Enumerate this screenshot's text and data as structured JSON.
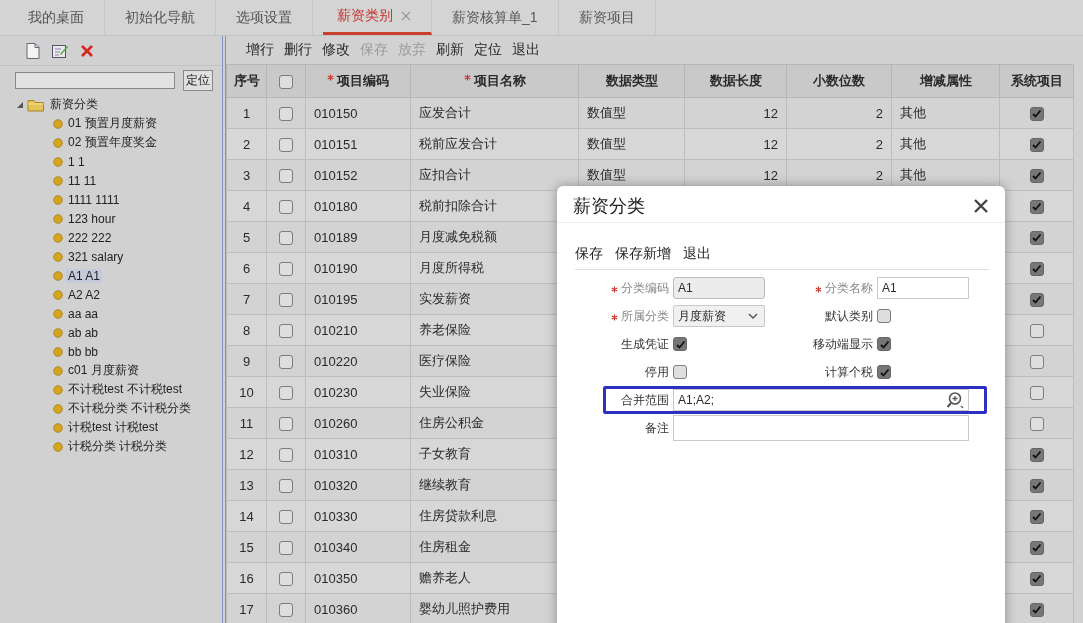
{
  "tabs": [
    {
      "label": "我的桌面",
      "selected": false,
      "closable": false
    },
    {
      "label": "初始化导航",
      "selected": false,
      "closable": false
    },
    {
      "label": "选项设置",
      "selected": false,
      "closable": false
    },
    {
      "label": "薪资类别",
      "selected": true,
      "closable": true
    },
    {
      "label": "薪资核算单_1",
      "selected": false,
      "closable": false
    },
    {
      "label": "薪资项目",
      "selected": false,
      "closable": false
    }
  ],
  "sidebar": {
    "search_button": "定位",
    "tree": [
      {
        "label": "薪资分类",
        "expanded": true,
        "selected": false,
        "children": [
          {
            "label": "01 预置月度薪资",
            "selected": false
          },
          {
            "label": "02 预置年度奖金",
            "selected": false
          },
          {
            "label": "1 1",
            "selected": false
          },
          {
            "label": "11 11",
            "selected": false
          },
          {
            "label": "1111 1111",
            "selected": false
          },
          {
            "label": "123 hour",
            "selected": false
          },
          {
            "label": "222 222",
            "selected": false
          },
          {
            "label": "321 salary",
            "selected": false
          },
          {
            "label": "A1 A1",
            "selected": true
          },
          {
            "label": "A2 A2",
            "selected": false
          },
          {
            "label": "aa aa",
            "selected": false
          },
          {
            "label": "ab ab",
            "selected": false
          },
          {
            "label": "bb bb",
            "selected": false
          },
          {
            "label": "c01 月度薪资",
            "selected": false
          },
          {
            "label": "不计税test 不计税test",
            "selected": false
          },
          {
            "label": "不计税分类 不计税分类",
            "selected": false
          },
          {
            "label": "计税test 计税test",
            "selected": false
          },
          {
            "label": "计税分类 计税分类",
            "selected": false
          }
        ]
      }
    ]
  },
  "toolbar": [
    {
      "label": "增行",
      "disabled": false
    },
    {
      "label": "删行",
      "disabled": false
    },
    {
      "label": "修改",
      "disabled": false
    },
    {
      "label": "保存",
      "disabled": true
    },
    {
      "label": "放弃",
      "disabled": true
    },
    {
      "label": "刷新",
      "disabled": false
    },
    {
      "label": "定位",
      "disabled": false
    },
    {
      "label": "退出",
      "disabled": false
    }
  ],
  "table": {
    "select_all_checked": false,
    "columns": [
      {
        "kind": "text",
        "label": "序号",
        "required": false
      },
      {
        "kind": "checkbox"
      },
      {
        "kind": "text",
        "label": "项目编码",
        "required": true
      },
      {
        "kind": "text",
        "label": "项目名称",
        "required": true
      },
      {
        "kind": "text",
        "label": "数据类型",
        "required": false
      },
      {
        "kind": "text",
        "label": "数据长度",
        "required": false
      },
      {
        "kind": "text",
        "label": "小数位数",
        "required": false
      },
      {
        "kind": "text",
        "label": "增减属性",
        "required": false
      },
      {
        "kind": "text",
        "label": "系统项目",
        "required": false
      }
    ],
    "rows": [
      {
        "no": "1",
        "checked": false,
        "code": "010150",
        "name": "应发合计",
        "type": "数值型",
        "length": "12",
        "decimals": "2",
        "attr": "其他",
        "system": true
      },
      {
        "no": "2",
        "checked": false,
        "code": "010151",
        "name": "税前应发合计",
        "type": "数值型",
        "length": "12",
        "decimals": "2",
        "attr": "其他",
        "system": true
      },
      {
        "no": "3",
        "checked": false,
        "code": "010152",
        "name": "应扣合计",
        "type": "数值型",
        "length": "12",
        "decimals": "2",
        "attr": "其他",
        "system": true
      },
      {
        "no": "4",
        "checked": false,
        "code": "010180",
        "name": "税前扣除合计",
        "system": true
      },
      {
        "no": "5",
        "checked": false,
        "code": "010189",
        "name": "月度减免税额",
        "system": true
      },
      {
        "no": "6",
        "checked": false,
        "code": "010190",
        "name": "月度所得税",
        "system": true
      },
      {
        "no": "7",
        "checked": false,
        "code": "010195",
        "name": "实发薪资",
        "system": true
      },
      {
        "no": "8",
        "checked": false,
        "code": "010210",
        "name": "养老保险",
        "system": false
      },
      {
        "no": "9",
        "checked": false,
        "code": "010220",
        "name": "医疗保险",
        "system": false
      },
      {
        "no": "10",
        "checked": false,
        "code": "010230",
        "name": "失业保险",
        "system": false
      },
      {
        "no": "11",
        "checked": false,
        "code": "010260",
        "name": "住房公积金",
        "system": false
      },
      {
        "no": "12",
        "checked": false,
        "code": "010310",
        "name": "子女教育",
        "system": true
      },
      {
        "no": "13",
        "checked": false,
        "code": "010320",
        "name": "继续教育",
        "system": true
      },
      {
        "no": "14",
        "checked": false,
        "code": "010330",
        "name": "住房贷款利息",
        "system": true
      },
      {
        "no": "15",
        "checked": false,
        "code": "010340",
        "name": "住房租金",
        "system": true
      },
      {
        "no": "16",
        "checked": false,
        "code": "010350",
        "name": "赡养老人",
        "system": true
      },
      {
        "no": "17",
        "checked": false,
        "code": "010360",
        "name": "婴幼儿照护费用",
        "system": true
      }
    ]
  },
  "dialog": {
    "title": "薪资分类",
    "toolbar": [
      "保存",
      "保存新增",
      "退出"
    ],
    "fields": [
      {
        "kind": "text",
        "label": "分类编码",
        "required": true,
        "value": "A1",
        "disabled": true
      },
      {
        "kind": "text",
        "label": "分类名称",
        "required": true,
        "value": "A1",
        "disabled": false
      },
      {
        "kind": "select",
        "label": "所属分类",
        "required": true,
        "value": "月度薪资"
      },
      {
        "kind": "checkbox",
        "label": "默认类别",
        "checked": false
      },
      {
        "kind": "checkbox",
        "label": "生成凭证",
        "checked": true
      },
      {
        "kind": "checkbox",
        "label": "移动端显示",
        "checked": true
      },
      {
        "kind": "checkbox",
        "label": "停用",
        "checked": false
      },
      {
        "kind": "checkbox",
        "label": "计算个税",
        "checked": true
      },
      {
        "kind": "lookup",
        "label": "合并范围",
        "value": "A1;A2;",
        "highlighted": true
      },
      {
        "kind": "textarea",
        "label": "备注"
      }
    ]
  }
}
